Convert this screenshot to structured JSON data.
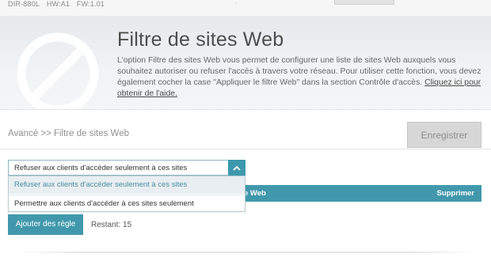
{
  "device": {
    "model": "DIR-880L",
    "hw": "HW:A1",
    "fw": "FW:1.01"
  },
  "header": {
    "title": "Filtre de sites Web",
    "description": "L'option Filtre des sites Web vous permet de configurer une liste de sites Web auxquels vous souhaitez autoriser ou refuser l'accès à travers votre réseau. Pour utiliser cette fonction, vous devez également cocher la case \"Appliquer le filtre Web\" dans la section Contrôle d'accès. ",
    "help_link": "Cliquez ici pour obtenir de l'aide."
  },
  "breadcrumb": "Avancé >> Filtre de sites Web",
  "save_button": "Enregistrer",
  "filter_mode": {
    "selected": "Refuser aux clients d'accéder seulement à ces sites",
    "options": [
      "Refuser aux clients d'accéder seulement à ces sites",
      "Permettre aux clients d'accéder à ces sites seulement"
    ]
  },
  "table": {
    "url_header_visible": "e Web",
    "delete_header": "Supprimer"
  },
  "add_button": "Ajouter des règle",
  "remaining": "Restant: 15",
  "colors": {
    "accent": "#4198ac",
    "save_disabled_bg": "#d7d7d7"
  }
}
